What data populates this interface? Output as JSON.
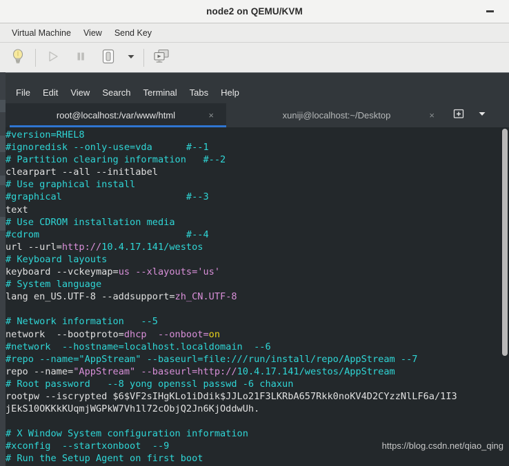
{
  "vm_window": {
    "title": "node2 on QEMU/KVM",
    "minimize_label": "–",
    "menus": [
      {
        "label": "Virtual Machine",
        "name": "menu-virtual-machine"
      },
      {
        "label": "View",
        "name": "menu-view"
      },
      {
        "label": "Send Key",
        "name": "menu-send-key"
      }
    ],
    "toolbar": [
      {
        "name": "show-details-button",
        "icon": "lightbulb-icon",
        "enabled": true
      },
      {
        "name": "run-button",
        "icon": "play-icon",
        "enabled": false
      },
      {
        "name": "pause-button",
        "icon": "pause-icon",
        "enabled": true
      },
      {
        "name": "shutdown-button",
        "icon": "power-icon",
        "enabled": true
      },
      {
        "name": "shutdown-options-button",
        "icon": "chevron-down-icon",
        "enabled": true
      },
      {
        "name": "fullscreen-button",
        "icon": "screens-icon",
        "enabled": true
      }
    ]
  },
  "terminal": {
    "menus": [
      {
        "label": "File",
        "name": "term-menu-file"
      },
      {
        "label": "Edit",
        "name": "term-menu-edit"
      },
      {
        "label": "View",
        "name": "term-menu-view"
      },
      {
        "label": "Search",
        "name": "term-menu-search"
      },
      {
        "label": "Terminal",
        "name": "term-menu-terminal"
      },
      {
        "label": "Tabs",
        "name": "term-menu-tabs"
      },
      {
        "label": "Help",
        "name": "term-menu-help"
      }
    ],
    "tabs": [
      {
        "label": "root@localhost:/var/www/html",
        "active": true,
        "close_label": "×"
      },
      {
        "label": "xuniji@localhost:~/Desktop",
        "active": false,
        "close_label": "×"
      }
    ],
    "new_tab_label": "+",
    "tab_menu_label": "▾",
    "lines": [
      [
        {
          "t": "#version=RHEL8",
          "c": "comment"
        }
      ],
      [
        {
          "t": "#ignoredisk --only-use=vda      #--1",
          "c": "comment"
        }
      ],
      [
        {
          "t": "# Partition clearing information   #--2",
          "c": "comment"
        }
      ],
      [
        {
          "t": "clearpart --all --initlabel",
          "c": "plain"
        }
      ],
      [
        {
          "t": "# Use graphical install",
          "c": "comment"
        }
      ],
      [
        {
          "t": "#graphical                      #--3",
          "c": "comment"
        }
      ],
      [
        {
          "t": "text",
          "c": "plain"
        }
      ],
      [
        {
          "t": "# Use CDROM installation media",
          "c": "comment"
        }
      ],
      [
        {
          "t": "#cdrom                          #--4",
          "c": "comment"
        }
      ],
      [
        {
          "t": "url --url=",
          "c": "plain"
        },
        {
          "t": "http://",
          "c": "val"
        },
        {
          "t": "10.4.17.141/westos",
          "c": "comment"
        }
      ],
      [
        {
          "t": "# Keyboard layouts",
          "c": "comment"
        }
      ],
      [
        {
          "t": "keyboard --vckeymap=",
          "c": "plain"
        },
        {
          "t": "us",
          "c": "val"
        },
        {
          "t": " --xlayouts='us'",
          "c": "val"
        }
      ],
      [
        {
          "t": "# System language",
          "c": "comment"
        }
      ],
      [
        {
          "t": "lang en_US.UTF-8 --addsupport=",
          "c": "plain"
        },
        {
          "t": "zh_CN.UTF-8",
          "c": "val"
        }
      ],
      [
        {
          "t": "",
          "c": "plain"
        }
      ],
      [
        {
          "t": "# Network information   --5",
          "c": "comment"
        }
      ],
      [
        {
          "t": "network  --bootproto=",
          "c": "plain"
        },
        {
          "t": "dhcp",
          "c": "val"
        },
        {
          "t": "  --onboot=",
          "c": "val"
        },
        {
          "t": "on",
          "c": "yellow"
        }
      ],
      [
        {
          "t": "#network  --hostname=localhost.localdomain  --6",
          "c": "comment"
        }
      ],
      [
        {
          "t": "#repo --name=\"AppStream\" --baseurl=file:///run/install/repo/AppStream --7",
          "c": "comment"
        }
      ],
      [
        {
          "t": "repo --name=",
          "c": "plain"
        },
        {
          "t": "\"AppStream\"",
          "c": "val"
        },
        {
          "t": " --baseurl=",
          "c": "val"
        },
        {
          "t": "http://",
          "c": "val"
        },
        {
          "t": "10.4.17.141/westos/AppStream",
          "c": "comment"
        }
      ],
      [
        {
          "t": "# Root password   --8 yong openssl passwd -6 chaxun",
          "c": "comment"
        }
      ],
      [
        {
          "t": "rootpw --iscrypted $6$VF2sIHgKLo1iDdik$JJLo21F3LKRbA657Rkk0noKV4D2CYzzNlLF6a/1I3",
          "c": "plain"
        }
      ],
      [
        {
          "t": "jEkS10OKKkKUqmjWGPkW7Vh1l72cObjQ2Jn6KjOddwUh.",
          "c": "plain"
        }
      ],
      [
        {
          "t": "",
          "c": "plain"
        }
      ],
      [
        {
          "t": "# X Window System configuration information",
          "c": "comment"
        }
      ],
      [
        {
          "t": "#xconfig  --startxonboot  --9",
          "c": "comment"
        }
      ],
      [
        {
          "t": "# Run the Setup Agent on first boot",
          "c": "comment"
        }
      ]
    ]
  },
  "watermark": "https://blog.csdn.net/qiao_qing",
  "colors": {
    "comment": "#2fd6d6",
    "plain": "#e0e0e0",
    "value": "#d88fd8",
    "yellow": "#e8d21a",
    "tab_accent": "#2f76d2",
    "terminal_bg": "#23282b",
    "chrome_bg": "#ececeb"
  }
}
